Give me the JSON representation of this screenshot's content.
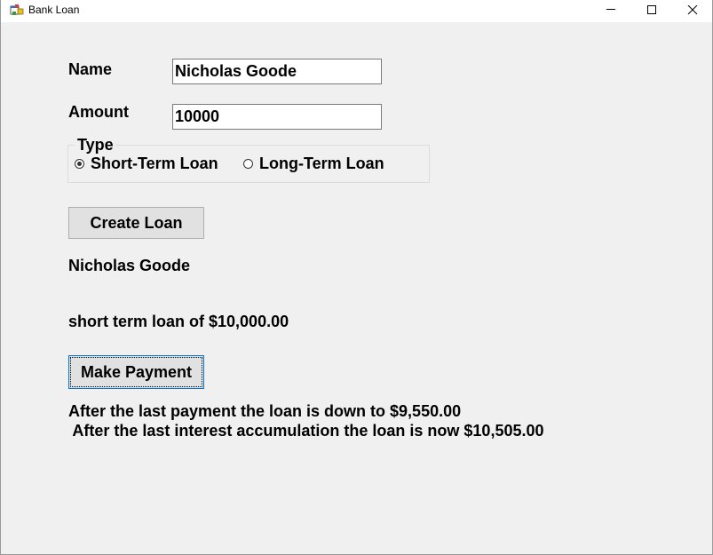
{
  "window": {
    "title": "Bank Loan"
  },
  "form": {
    "name_label": "Name",
    "name_value": "Nicholas Goode",
    "amount_label": "Amount",
    "amount_value": "10000",
    "type_label": "Type",
    "radio_short": "Short-Term Loan",
    "radio_long": "Long-Term Loan",
    "selected_type": "Short-Term Loan",
    "create_button": "Create Loan",
    "make_payment_button": "Make Payment"
  },
  "output": {
    "customer_name": "Nicholas Goode",
    "loan_summary": "short term loan of $10,000.00",
    "payment_line": "After the last payment the loan is down to $9,550.00",
    "interest_line": " After the last interest accumulation the loan is now $10,505.00"
  },
  "colors": {
    "focus_border": "#0078d7",
    "window_bg": "#f0f0f0",
    "button_bg": "#e1e1e1"
  }
}
